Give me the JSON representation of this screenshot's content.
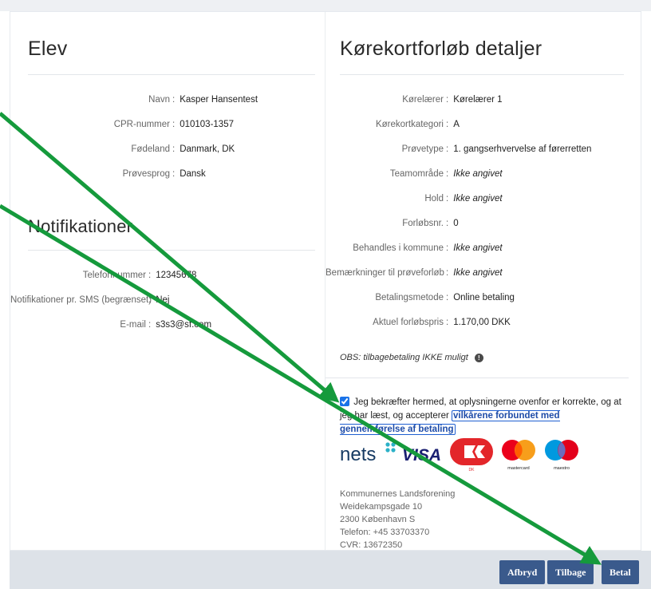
{
  "left": {
    "elev_title": "Elev",
    "elev_rows": [
      {
        "label": "Navn",
        "value": "Kasper Hansentest"
      },
      {
        "label": "CPR-nummer",
        "value": "010103-1357"
      },
      {
        "label": "Fødeland",
        "value": "Danmark, DK"
      },
      {
        "label": "Prøvesprog",
        "value": "Dansk"
      }
    ],
    "notif_title": "Notifikationer",
    "notif_rows": [
      {
        "label": "Telefonnummer",
        "value": "12345678"
      },
      {
        "label": "Notifikationer pr. SMS (begrænset)",
        "value": "Nej"
      },
      {
        "label": "E-mail",
        "value": "s3s3@sf.com"
      }
    ]
  },
  "right": {
    "title": "Kørekortforløb detaljer",
    "rows": [
      {
        "label": "Kørelærer",
        "value": "Kørelærer 1",
        "italic": false
      },
      {
        "label": "Kørekortkategori",
        "value": "A",
        "italic": false
      },
      {
        "label": "Prøvetype",
        "value": "1. gangserhvervelse af førerretten",
        "italic": false
      },
      {
        "label": "Teamområde",
        "value": "Ikke angivet",
        "italic": true
      },
      {
        "label": "Hold",
        "value": "Ikke angivet",
        "italic": true
      },
      {
        "label": "Forløbsnr.",
        "value": "0",
        "italic": false
      },
      {
        "label": "Behandles i kommune",
        "value": "Ikke angivet",
        "italic": true
      },
      {
        "label": "Bemærkninger til prøveforløb",
        "value": "Ikke angivet",
        "italic": true
      },
      {
        "label": "Betalingsmetode",
        "value": "Online betaling",
        "italic": false
      },
      {
        "label": "Aktuel forløbspris",
        "value": "1.170,00 DKK",
        "italic": false
      }
    ],
    "sep": ":",
    "obs_text": "OBS: tilbagebetaling IKKE muligt",
    "info_icon": "!",
    "consent_text": "Jeg bekræfter hermed, at oplysningerne ovenfor er korrekte, og at jeg har læst, og accepterer",
    "consent_link": "vilkårene forbundet med gennemførelse af betaling",
    "consent_checked": true,
    "logos": {
      "nets": "nets",
      "visa": "VISA",
      "dankort": "DK",
      "mastercard": "mastercard",
      "maestro": "maestro"
    },
    "address_lines": [
      "Kommunernes Landsforening",
      "Weidekampsgade 10",
      "2300 København S",
      "Telefon: +45 33703370",
      "CVR: 13672350"
    ]
  },
  "buttons": {
    "cancel": "Afbryd",
    "back": "Tilbage",
    "pay": "Betal"
  },
  "colors": {
    "button_bg": "#3a5a8c",
    "arrow": "#159a3c",
    "footer_bg": "#dde2e8",
    "link": "#1d4ba8"
  }
}
